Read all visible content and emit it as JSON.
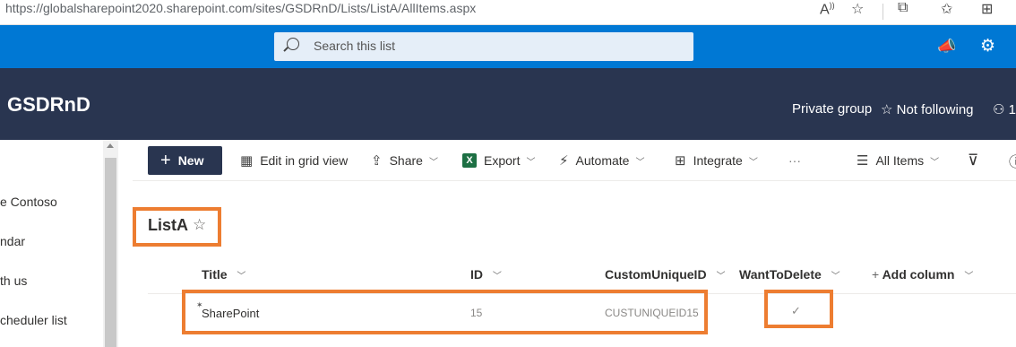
{
  "browser": {
    "url": "https://globalsharepoint2020.sharepoint.com/sites/GSDRnD/Lists/ListA/AllItems.aspx"
  },
  "suite": {
    "search_placeholder": "Search this list"
  },
  "site": {
    "title": "GSDRnD",
    "private_group": "Private group",
    "following": "Not following",
    "members": "1"
  },
  "nav": {
    "items": [
      "e Contoso",
      "ndar",
      "th us",
      "cheduler list"
    ]
  },
  "commands": {
    "new": "New",
    "edit_grid": "Edit in grid view",
    "share": "Share",
    "export": "Export",
    "automate": "Automate",
    "integrate": "Integrate",
    "more": "···",
    "view": "All Items"
  },
  "list": {
    "title": "ListA",
    "columns": {
      "title": "Title",
      "id": "ID",
      "custom_id": "CustomUniqueID",
      "want_delete": "WantToDelete",
      "add_column": "Add column"
    },
    "rows": [
      {
        "title": "SharePoint",
        "id": "15",
        "custom_id": "CUSTUNIQUEID15",
        "want_delete": "✓"
      }
    ]
  },
  "colors": {
    "suite_bar": "#0078d4",
    "site_header": "#293550",
    "highlight": "#ed7d31"
  }
}
